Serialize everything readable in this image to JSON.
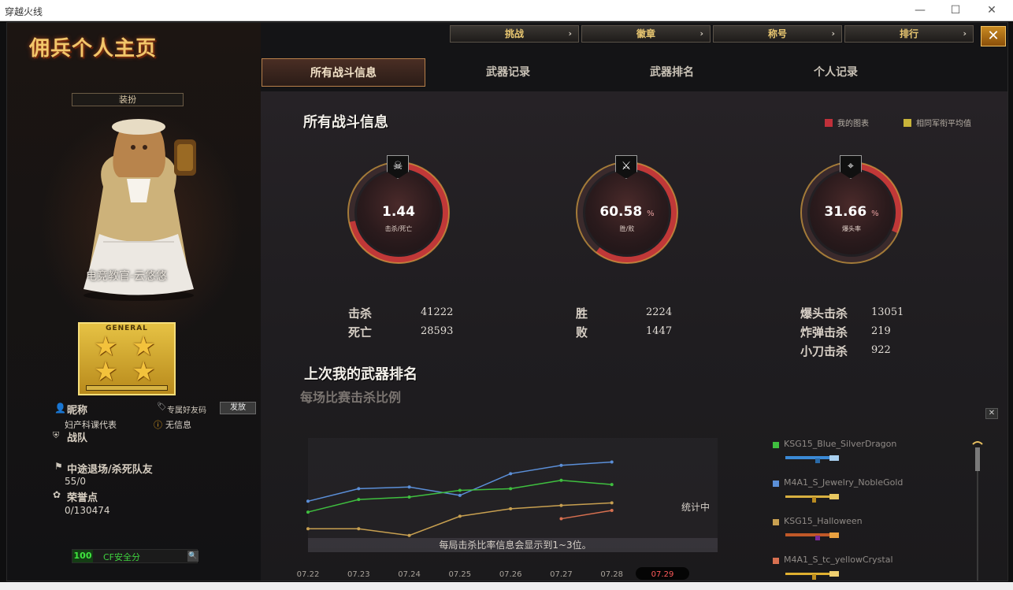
{
  "window": {
    "title": "穿越火线",
    "minimize_label": "—",
    "maximize_label": "☐",
    "close_label": "✕"
  },
  "logo": "佣兵个人主页",
  "left": {
    "equip_label": "装扮",
    "player_name": "电竞教官-云悠悠",
    "rank_text": "GENERAL",
    "nickname_label": "昵称",
    "nickname_value": "妇产科课代表",
    "friendcode_label": "专属好友码",
    "send_button": "发放",
    "no_info": "无信息",
    "team_label": "战队",
    "quit_label": "中途退场/杀死队友",
    "quit_value": "55/0",
    "honor_label": "荣誉点",
    "honor_value": "0/130474",
    "safety_score": "100",
    "safety_label": "CF安全分"
  },
  "top_buttons": [
    {
      "label": "挑战"
    },
    {
      "label": "徽章"
    },
    {
      "label": "称号"
    },
    {
      "label": "排行"
    }
  ],
  "close_button": "✕",
  "tabs": [
    {
      "label": "所有战斗信息",
      "active": true
    },
    {
      "label": "武器记录",
      "active": false
    },
    {
      "label": "武器排名",
      "active": false
    },
    {
      "label": "个人记录",
      "active": false
    }
  ],
  "battle": {
    "title": "所有战斗信息",
    "legend_mine": "我的图表",
    "legend_avg": "相同军衔平均值",
    "gauges": [
      {
        "value": "1.44",
        "unit": "",
        "label": "击杀/死亡",
        "icon": "skull-crossbones-icon",
        "fraction": 0.72
      },
      {
        "value": "60.58",
        "unit": "%",
        "label": "胜/败",
        "icon": "crossed-rifles-icon",
        "fraction": 0.6058
      },
      {
        "value": "31.66",
        "unit": "%",
        "label": "爆头率",
        "icon": "sniper-icon",
        "fraction": 0.3166
      }
    ],
    "kills_label": "击杀",
    "kills_value": "41222",
    "deaths_label": "死亡",
    "deaths_value": "28593",
    "wins_label": "胜",
    "wins_value": "2224",
    "losses_label": "败",
    "losses_value": "1447",
    "headshot_label": "爆头击杀",
    "headshot_value": "13051",
    "grenade_label": "炸弹击杀",
    "grenade_value": "219",
    "knife_label": "小刀击杀",
    "knife_value": "922"
  },
  "weapon_rank": {
    "title": "上次我的武器排名",
    "subtitle": "每场比赛击杀比例",
    "status": "统计中",
    "footer_note": "每局击杀比率信息会显示到1~3位。",
    "weapons": [
      {
        "name": "KSG15_Blue_SilverDragon",
        "color": "#3fbf3f"
      },
      {
        "name": "M4A1_S_Jewelry_NobleGold",
        "color": "#5b8fd8"
      },
      {
        "name": "KSG15_Halloween",
        "color": "#c8a050"
      },
      {
        "name": "M4A1_S_tc_yellowCrystal",
        "color": "#d87050"
      }
    ]
  },
  "chart_data": {
    "type": "line",
    "categories": [
      "07.22",
      "07.23",
      "07.24",
      "07.25",
      "07.26",
      "07.27",
      "07.28",
      "07.29"
    ],
    "ylim": [
      0,
      1
    ],
    "series": [
      {
        "color": "#5b8fd8",
        "values": [
          0.45,
          0.6,
          0.62,
          0.52,
          0.78,
          0.88,
          0.92,
          null
        ]
      },
      {
        "color": "#3fbf3f",
        "values": [
          0.32,
          0.47,
          0.5,
          0.58,
          0.6,
          0.7,
          0.65,
          null
        ]
      },
      {
        "color": "#c8a050",
        "values": [
          0.12,
          0.12,
          0.04,
          0.27,
          0.36,
          0.4,
          0.43,
          null
        ]
      },
      {
        "color": "#d87050",
        "values": [
          null,
          null,
          null,
          null,
          null,
          0.24,
          0.34,
          null
        ]
      }
    ]
  }
}
